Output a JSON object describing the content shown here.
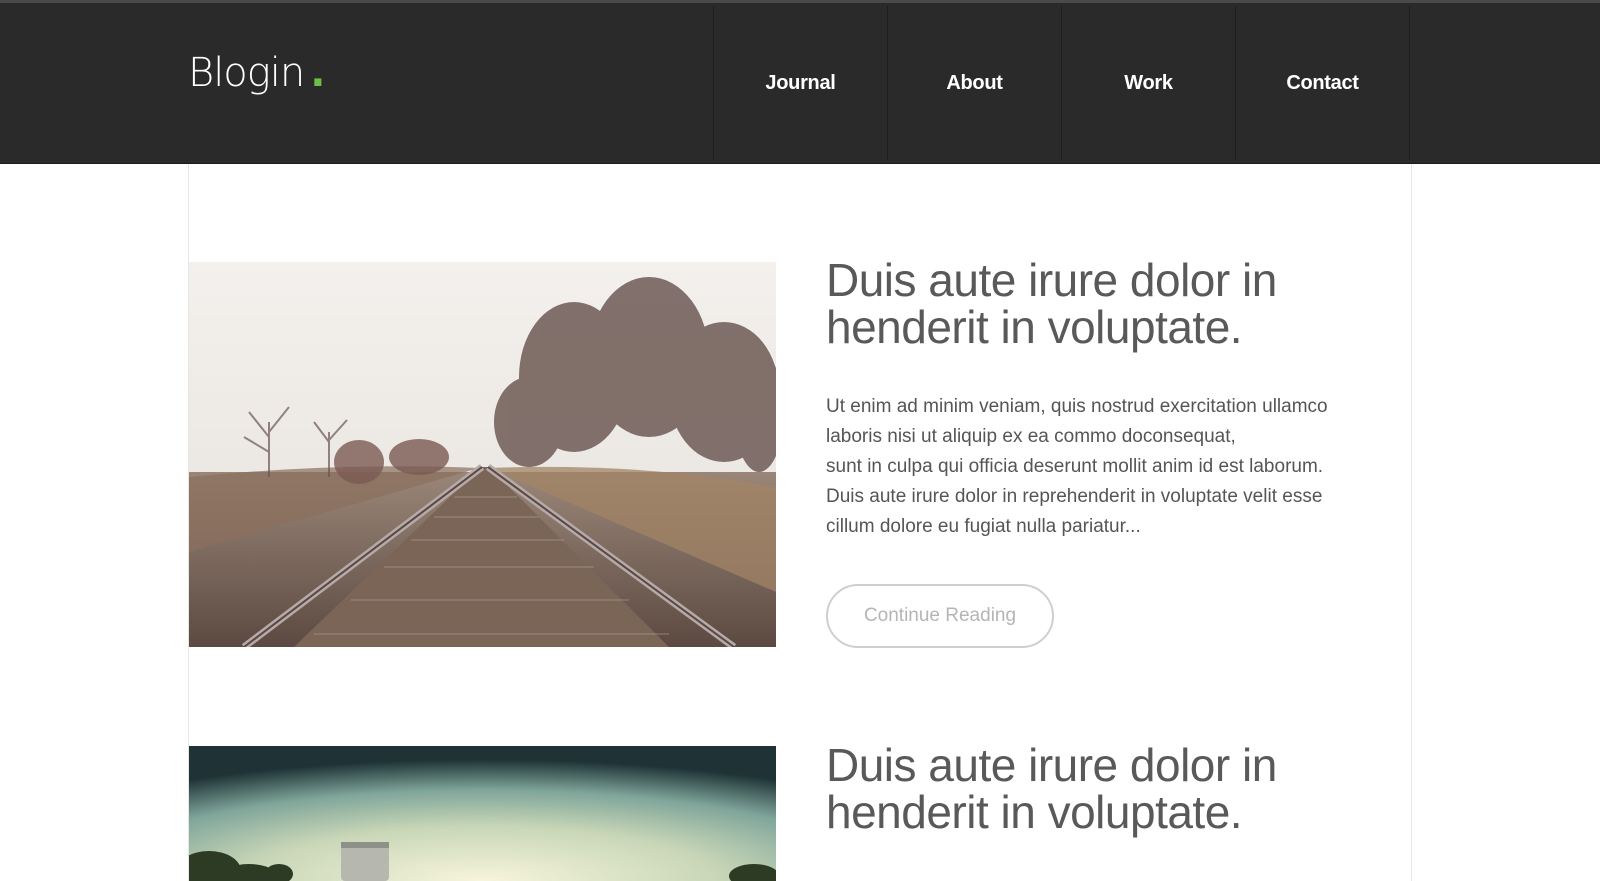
{
  "header": {
    "logo_text": "Blogin",
    "logo_dot": ".",
    "nav": [
      {
        "label": "Journal"
      },
      {
        "label": "About"
      },
      {
        "label": "Work"
      },
      {
        "label": "Contact"
      }
    ]
  },
  "posts": [
    {
      "image_name": "railroad-tracks-photo",
      "title": "Duis aute irure dolor in henderit in voluptate.",
      "excerpt_lines": [
        "Ut enim ad minim veniam, quis nostrud exercitation ullamco",
        "laboris nisi ut aliquip ex ea commo doconsequat,",
        "sunt in culpa qui officia deserunt mollit anim id est laborum.",
        "Duis aute irure dolor in reprehenderit in voluptate velit esse",
        "cillum dolore eu fugiat nulla pariatur..."
      ],
      "button_label": "Continue Reading"
    },
    {
      "image_name": "water-tower-photo",
      "title": "Duis aute irure dolor in henderit in voluptate."
    }
  ],
  "colors": {
    "header_bg": "#2a2a2a",
    "accent": "#6cc04a",
    "title_text": "#595959",
    "body_text": "#555555",
    "button_text": "#b5b5b5"
  }
}
